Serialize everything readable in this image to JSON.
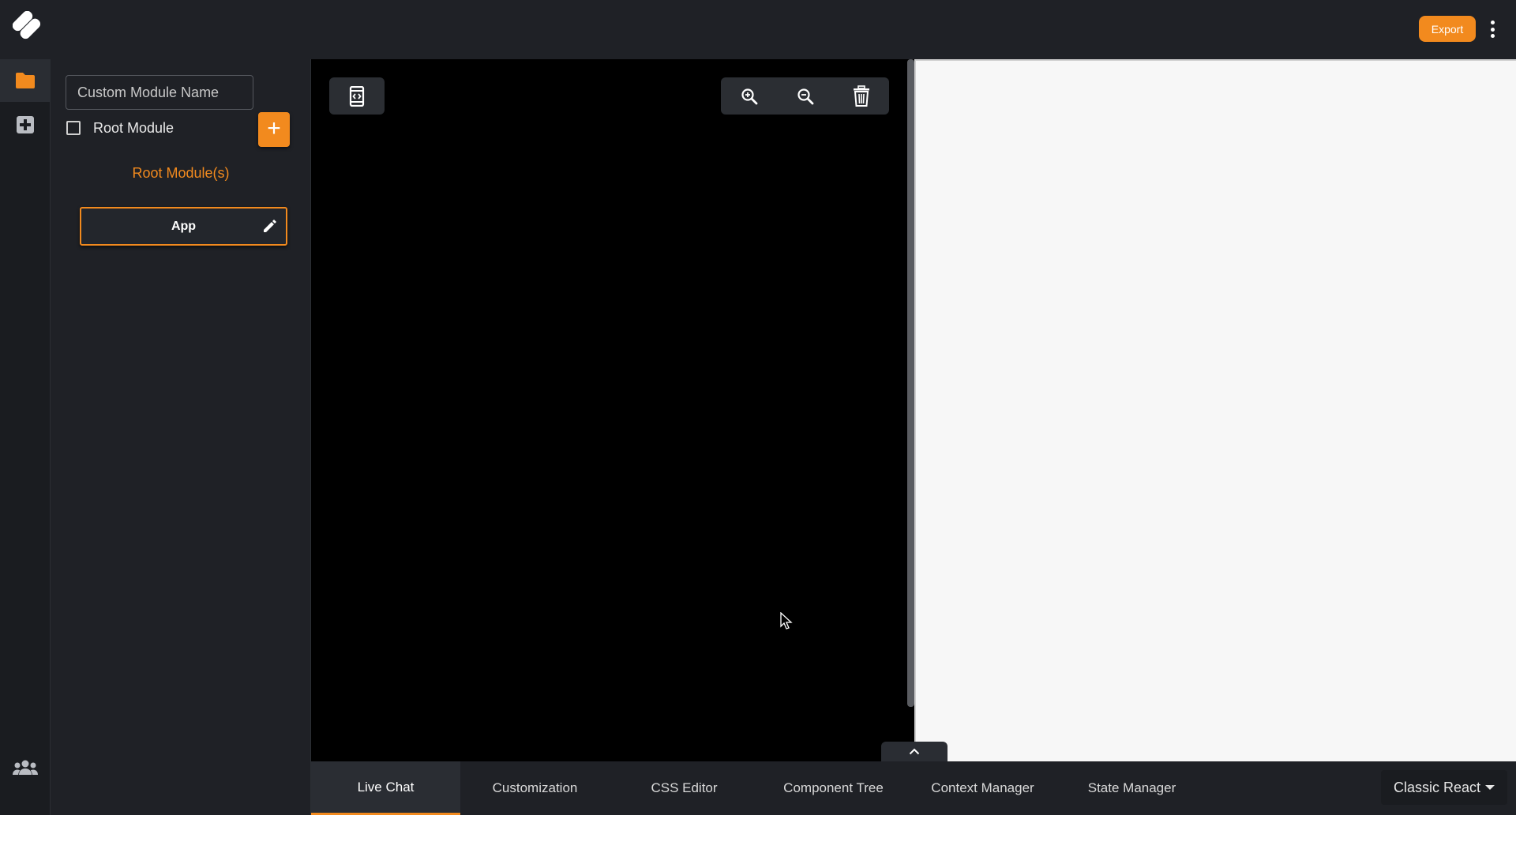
{
  "header": {
    "logo": "app-logo",
    "export_label": "Export",
    "menu_icon": "more-vertical-icon"
  },
  "rail": {
    "items": [
      {
        "icon": "folder-icon",
        "active": true
      },
      {
        "icon": "add-box-icon",
        "active": false
      }
    ],
    "bottom_icon": "people-icon"
  },
  "module_panel": {
    "name_input": {
      "placeholder": "Custom Module Name",
      "value": ""
    },
    "root_checkbox_label": "Root Module",
    "root_checked": false,
    "add_icon": "plus-icon",
    "section_title": "Root Module(s)",
    "modules": [
      {
        "name": "App",
        "icon": "pencil-icon"
      }
    ]
  },
  "canvas_toolbar": {
    "left": [
      "code-view-icon"
    ],
    "right": [
      "zoom-in-icon",
      "zoom-out-icon",
      "trash-icon"
    ]
  },
  "bottom_tabs": {
    "tabs": [
      {
        "label": "Live Chat",
        "active": true
      },
      {
        "label": "Customization",
        "active": false
      },
      {
        "label": "CSS Editor",
        "active": false
      },
      {
        "label": "Component Tree",
        "active": false
      },
      {
        "label": "Context Manager",
        "active": false
      },
      {
        "label": "State Manager",
        "active": false
      }
    ],
    "framework_select": "Classic React"
  },
  "colors": {
    "accent": "#f28a1e",
    "topbar": "#1f2126",
    "canvas": "#000000",
    "preview": "#f7f7f7"
  }
}
